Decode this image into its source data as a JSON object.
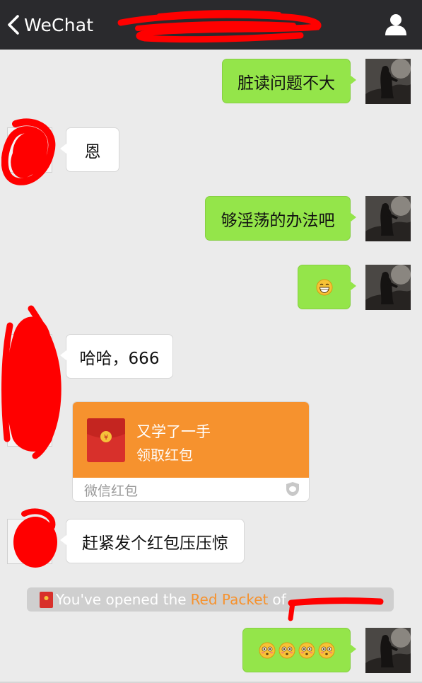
{
  "header": {
    "back_label": "WeChat",
    "contact_name": ""
  },
  "messages": [
    {
      "direction": "out",
      "text": "脏读问题不大"
    },
    {
      "direction": "in",
      "text": "恩"
    },
    {
      "direction": "out",
      "text": "够淫荡的办法吧"
    },
    {
      "direction": "out",
      "emoji": [
        "grinning-face"
      ]
    },
    {
      "direction": "in",
      "text": "哈哈，666"
    },
    {
      "direction": "in",
      "type": "red_packet",
      "title": "又学了一手",
      "action": "领取红包",
      "footer": "微信红包"
    },
    {
      "direction": "in",
      "text": "赶紧发个红包压压惊"
    },
    {
      "direction": "out",
      "emoji": [
        "flushed-face",
        "flushed-face",
        "flushed-face",
        "flushed-face"
      ]
    }
  ],
  "system_message": {
    "prefix": "You've opened the",
    "link": "Red Packet",
    "suffix": "of"
  },
  "colors": {
    "topbar": "#2a2a2d",
    "background": "#ebebeb",
    "outgoing_bubble": "#94e54a",
    "incoming_bubble": "#ffffff",
    "red_packet": "#f6922e",
    "redaction": "#ff0000"
  }
}
